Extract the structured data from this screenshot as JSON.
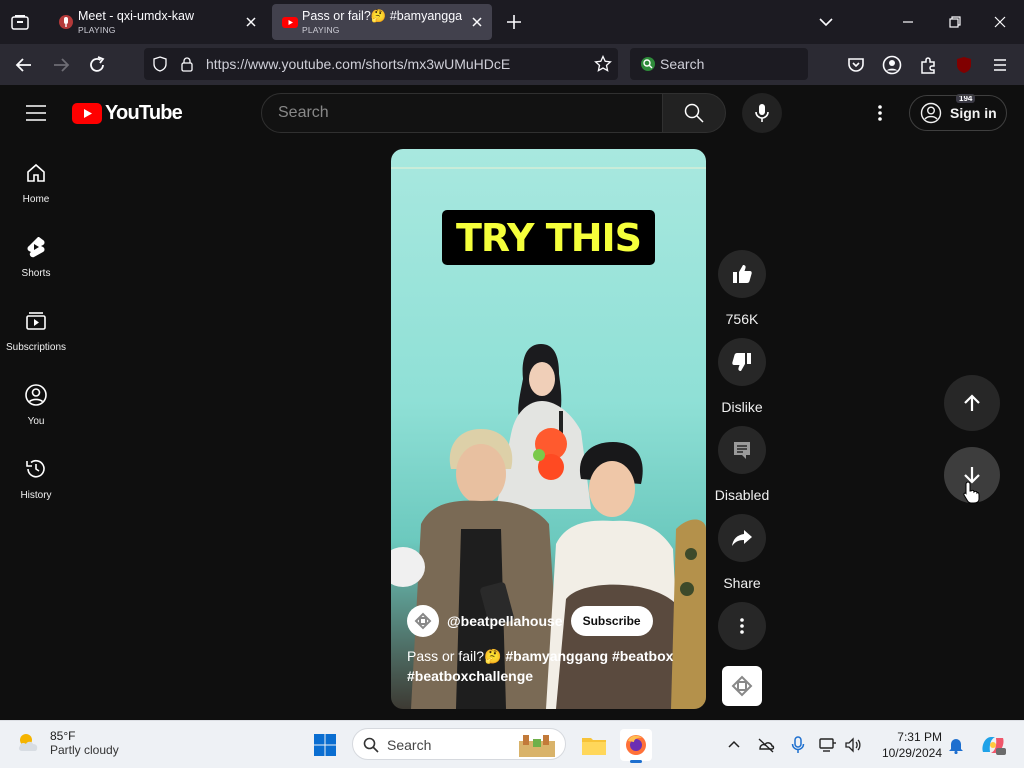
{
  "browser": {
    "tabs": [
      {
        "title": "Meet - qxi-umdx-kaw",
        "status": "PLAYING",
        "active": false
      },
      {
        "title": "Pass or fail?🤔 #bamyanggang",
        "status": "PLAYING",
        "active": true
      }
    ],
    "url": "https://www.youtube.com/shorts/mx3wUMuHDcE",
    "search_placeholder": "Search",
    "extension_badge": "194"
  },
  "youtube": {
    "logo_text": "YouTube",
    "search_placeholder": "Search",
    "sign_in_label": "Sign in",
    "guide": [
      {
        "label": "Home",
        "icon": "home-icon"
      },
      {
        "label": "Shorts",
        "icon": "shorts-icon"
      },
      {
        "label": "Subscriptions",
        "icon": "subscriptions-icon"
      },
      {
        "label": "You",
        "icon": "you-icon"
      },
      {
        "label": "History",
        "icon": "history-icon"
      }
    ]
  },
  "short": {
    "overlay_text": "TRY THIS",
    "channel": "@beatpellahouse",
    "subscribe_label": "Subscribe",
    "caption_text": "Pass or fail?🤔",
    "hashtags": [
      "#bamyanggang",
      "#beatbox",
      "#beatboxchallenge"
    ],
    "actions": {
      "like_count": "756K",
      "dislike_label": "Dislike",
      "comments_label": "Disabled",
      "share_label": "Share"
    }
  },
  "taskbar": {
    "weather_temp": "85°F",
    "weather_condition": "Partly cloudy",
    "search_placeholder": "Search",
    "time": "7:31 PM",
    "date": "10/29/2024"
  },
  "colors": {
    "yt_red": "#ff0000",
    "overlay_yellow": "#f5ff3b",
    "bg": "#0f0f0f"
  }
}
